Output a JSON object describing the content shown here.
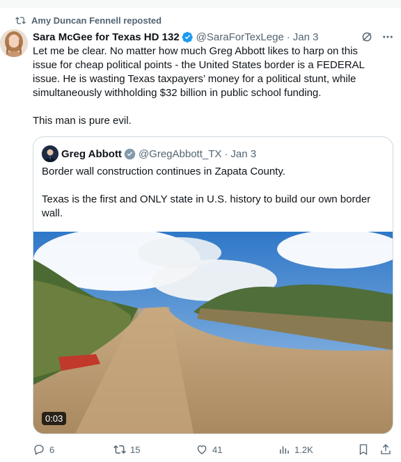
{
  "reposted_by": "Amy Duncan Fennell reposted",
  "tweet": {
    "name": "Sara McGee for Texas HD 132",
    "handle": "@SaraForTexLege",
    "separator": "·",
    "date": "Jan 3",
    "text": "Let me be clear. No matter how much Greg Abbott likes to harp on this issue for cheap political points - the United States border is a FEDERAL issue. He is wasting Texas taxpayers’ money for a political stunt, while simultaneously withholding $32 billion in public school funding.\n\nThis man is pure evil."
  },
  "quote": {
    "name": "Greg Abbott",
    "handle": "@GregAbbott_TX",
    "separator": "·",
    "date": "Jan 3",
    "text": "Border wall construction continues in Zapata County.\n\nTexas is the first and ONLY state in U.S. history to build our own border wall.",
    "video_duration": "0:03"
  },
  "actions": {
    "replies": "6",
    "reposts": "15",
    "likes": "41",
    "views": "1.2K"
  },
  "colors": {
    "verified": "#1d9bf0",
    "muted": "#536471",
    "text": "#0f1419"
  }
}
